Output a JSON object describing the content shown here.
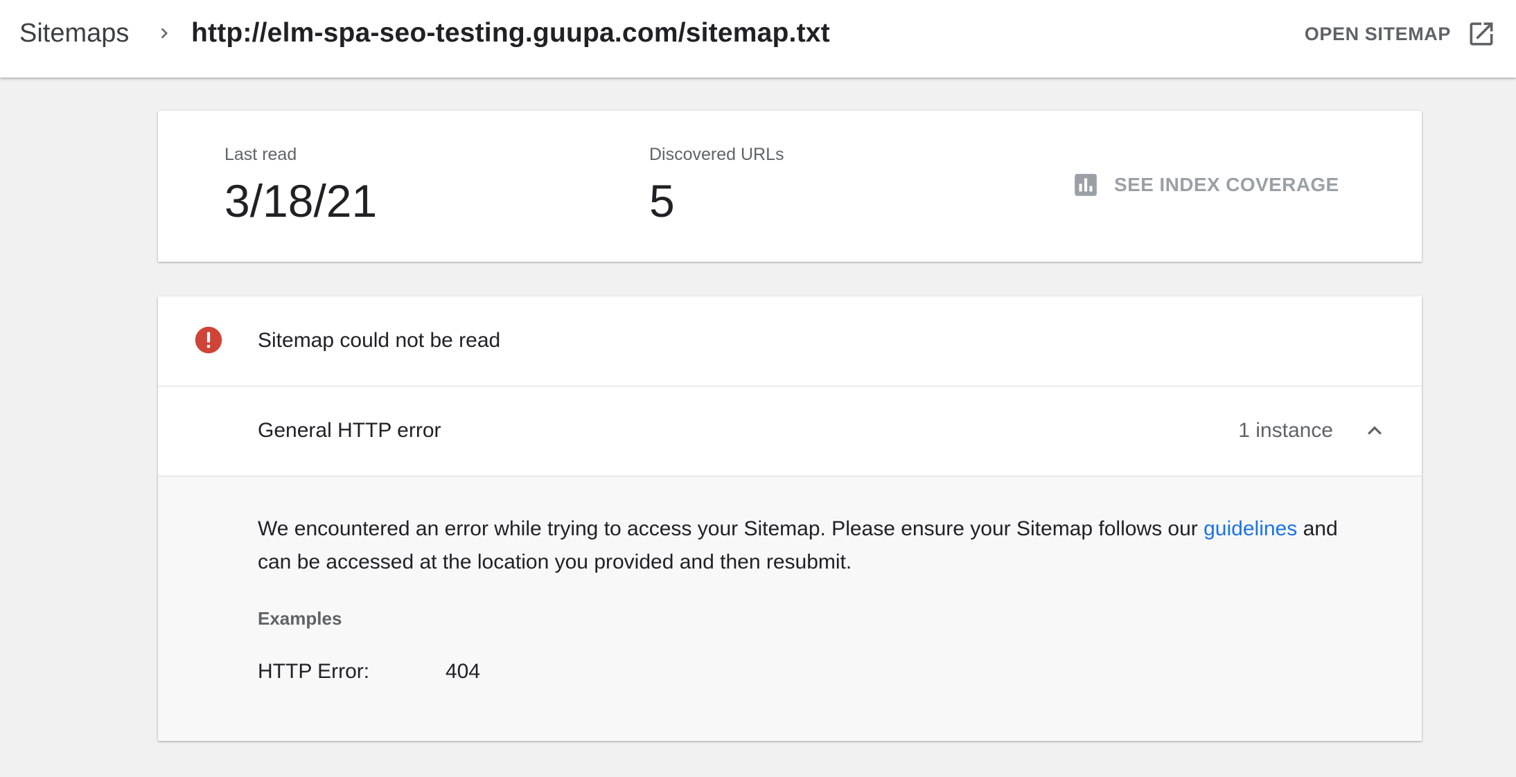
{
  "header": {
    "breadcrumb_root": "Sitemaps",
    "breadcrumb_current": "http://elm-spa-seo-testing.guupa.com/sitemap.txt",
    "open_sitemap_label": "OPEN SITEMAP",
    "icons": {
      "separator": "chevron-right-icon",
      "open": "open-in-new-icon"
    }
  },
  "summary": {
    "last_read_label": "Last read",
    "last_read_value": "3/18/21",
    "discovered_urls_label": "Discovered URLs",
    "discovered_urls_value": "5",
    "index_coverage_label": "SEE INDEX COVERAGE",
    "index_coverage_icon": "bar-chart-icon"
  },
  "errors": {
    "status_icon": "error-icon",
    "status_color": "#d04437",
    "title": "Sitemap could not be read",
    "issue": {
      "name": "General HTTP error",
      "count": "1 instance",
      "expanded": true
    },
    "detail": {
      "text_before": "We encountered an error while trying to access your Sitemap. Please ensure your Sitemap follows our ",
      "link": "guidelines",
      "text_after": " and can be accessed at the location you provided and then resubmit.",
      "examples_label": "Examples",
      "example_key": "HTTP Error:",
      "example_value": "404"
    }
  },
  "colors": {
    "link": "#1a73e8",
    "background": "#f1f1f1",
    "detail_background": "#f8f8f8"
  }
}
